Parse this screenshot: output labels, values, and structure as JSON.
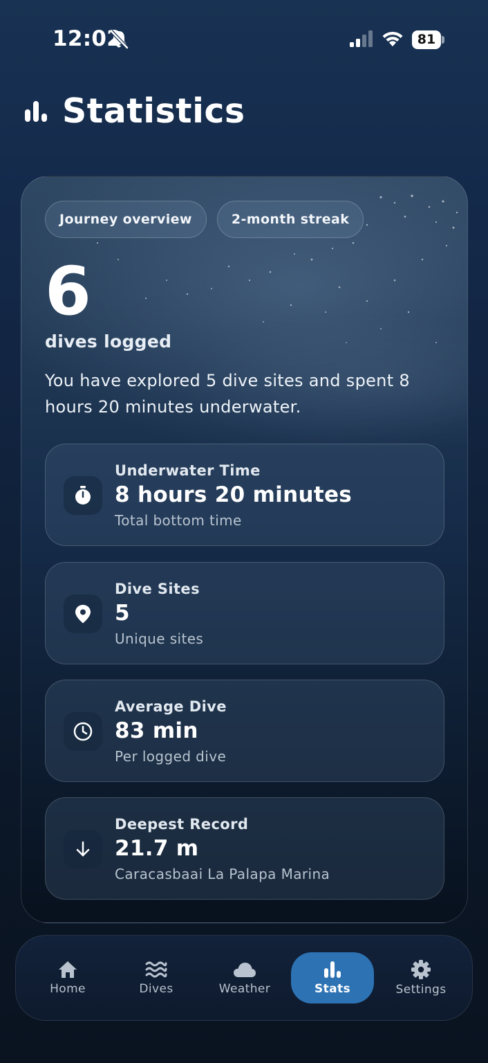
{
  "status_bar": {
    "time": "12:02",
    "battery_level": "81",
    "icons": [
      "bell-slash-icon",
      "cellular-signal-icon",
      "wifi-icon",
      "battery-icon"
    ]
  },
  "header": {
    "icon": "bar-chart-icon",
    "title": "Statistics"
  },
  "overview": {
    "chips": [
      "Journey overview",
      "2-month streak"
    ],
    "dive_count": "6",
    "dive_count_label": "dives logged",
    "summary": "You have explored 5 dive sites and spent 8 hours 20 minutes underwater.",
    "stats": [
      {
        "icon": "stopwatch-icon",
        "label": "Underwater Time",
        "value": "8 hours 20 minutes",
        "sub": "Total bottom time"
      },
      {
        "icon": "map-pin-icon",
        "label": "Dive Sites",
        "value": "5",
        "sub": "Unique sites"
      },
      {
        "icon": "clock-icon",
        "label": "Average Dive",
        "value": "83 min",
        "sub": "Per logged dive"
      },
      {
        "icon": "arrow-down-icon",
        "label": "Deepest Record",
        "value": "21.7 m",
        "sub": "Caracasbaai La Palapa Marina"
      }
    ]
  },
  "tab_bar": {
    "active": "Stats",
    "tabs": [
      {
        "label": "Home",
        "icon": "home-icon"
      },
      {
        "label": "Dives",
        "icon": "waves-icon"
      },
      {
        "label": "Weather",
        "icon": "cloud-icon"
      },
      {
        "label": "Stats",
        "icon": "bar-chart-icon"
      },
      {
        "label": "Settings",
        "icon": "gear-icon"
      }
    ]
  },
  "colors": {
    "background": "#14294a",
    "accent": "#2d73b4",
    "text_secondary": "#b8c4d0"
  }
}
